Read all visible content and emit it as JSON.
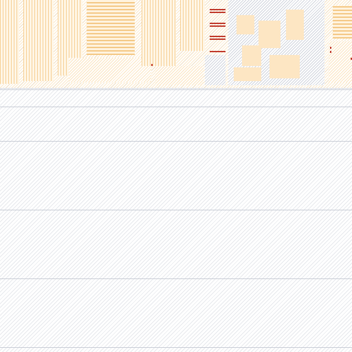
{
  "screen": {
    "background": "#ffffff",
    "texture_color": "#c9cdd6",
    "accent_pattern_color": "#f6cf94",
    "marker_color": "#c0392b"
  }
}
